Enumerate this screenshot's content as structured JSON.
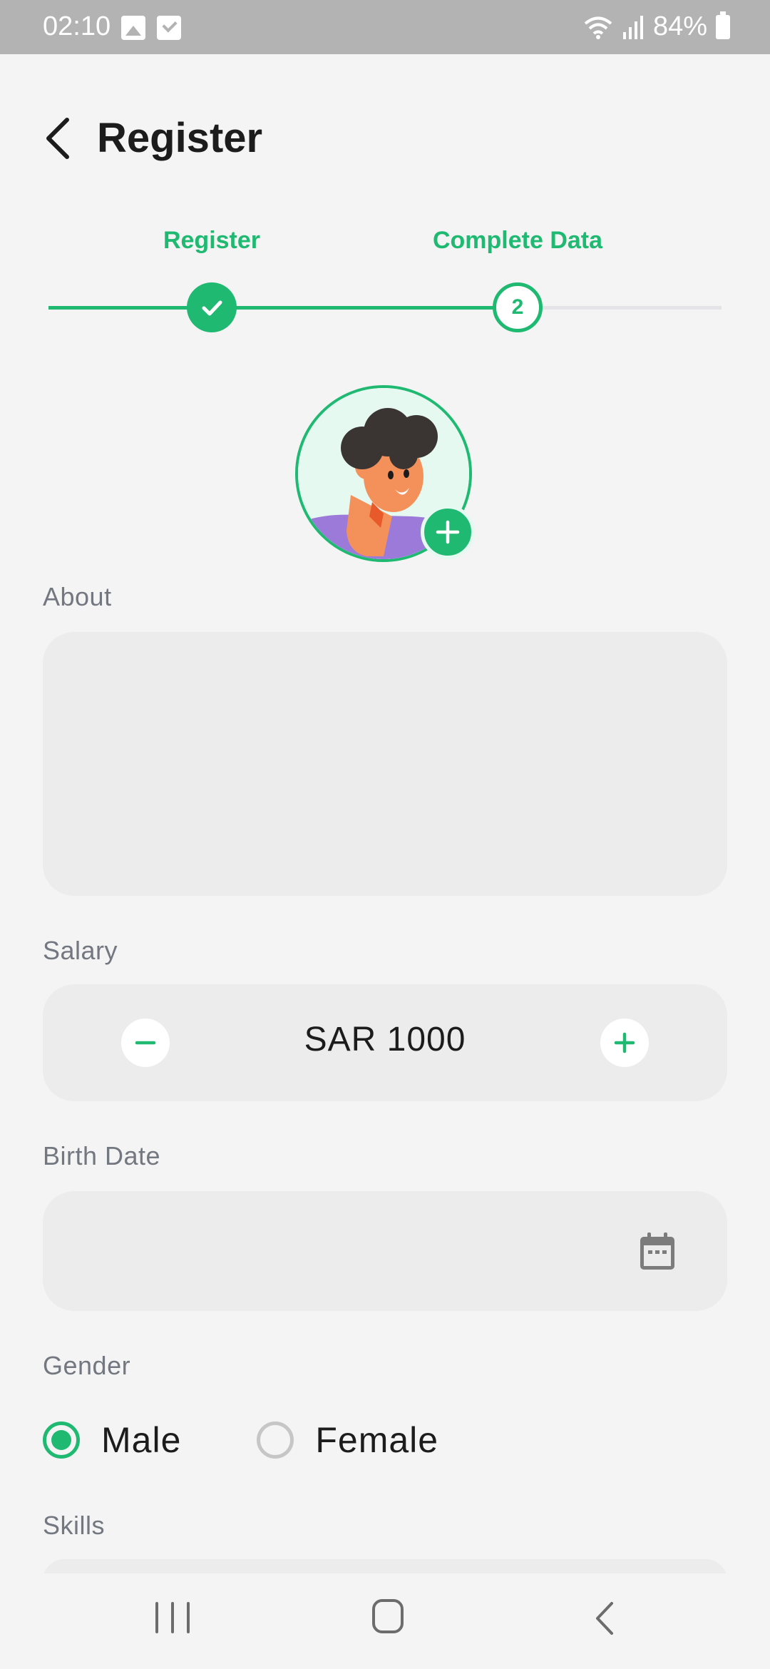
{
  "status_bar": {
    "time": "02:10",
    "battery": "84%",
    "icons": [
      "gallery-icon",
      "checkbox-icon",
      "wifi-icon",
      "signal-icon",
      "battery-icon"
    ]
  },
  "header": {
    "title": "Register",
    "back_icon": "chevron-left-icon"
  },
  "stepper": {
    "steps": [
      {
        "label": "Register",
        "state": "completed"
      },
      {
        "label": "Complete Data",
        "state": "current",
        "number": "2"
      }
    ]
  },
  "avatar": {
    "add_icon": "plus-icon"
  },
  "form": {
    "about": {
      "label": "About",
      "value": ""
    },
    "salary": {
      "label": "Salary",
      "value": "SAR 1000"
    },
    "birth_date": {
      "label": "Birth Date",
      "value": ""
    },
    "gender": {
      "label": "Gender",
      "options": [
        "Male",
        "Female"
      ],
      "selected": "Male"
    },
    "skills": {
      "label": "Skills"
    }
  },
  "colors": {
    "accent": "#1fb972",
    "background": "#f4f4f4",
    "field": "#ececec",
    "label": "#737880"
  }
}
